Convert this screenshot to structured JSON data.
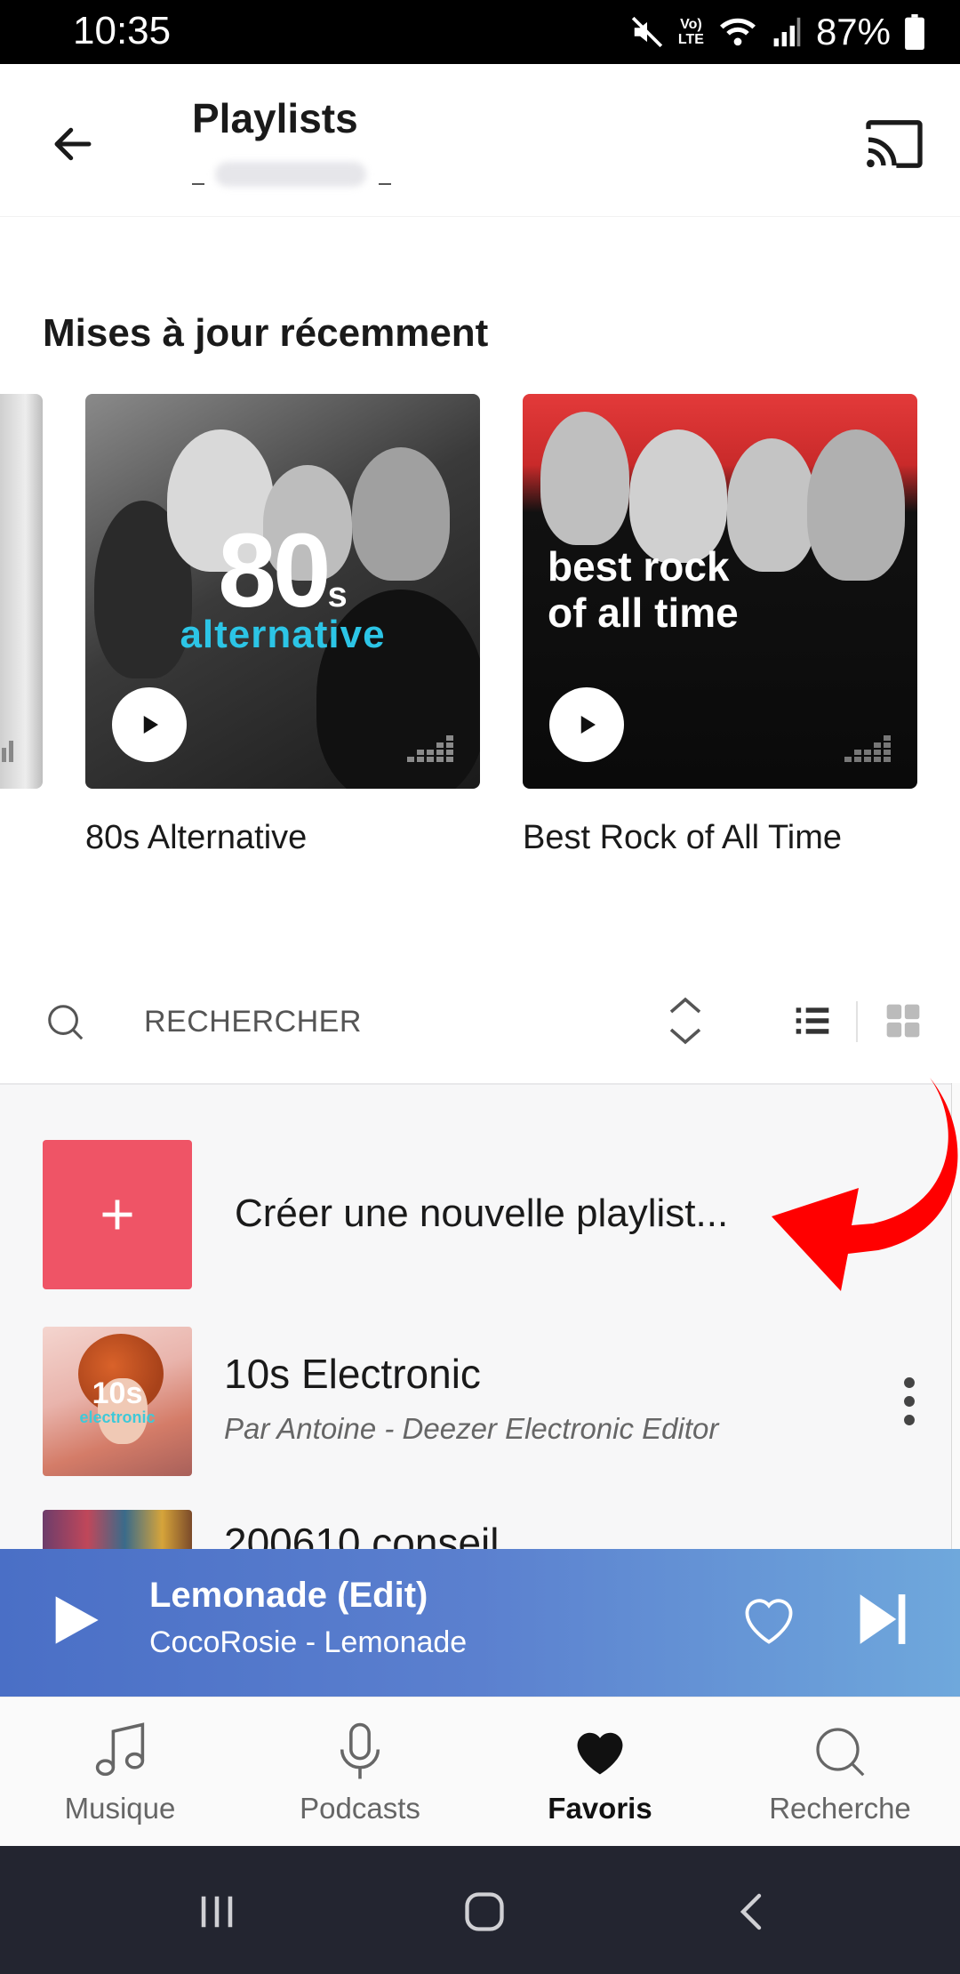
{
  "status_bar": {
    "time": "10:35",
    "network": "LTE",
    "volte": "Vo)",
    "battery": "87%"
  },
  "header": {
    "title": "Playlists"
  },
  "section": {
    "title": "Mises à jour récemment"
  },
  "cards": [
    {
      "cover_line1": "80",
      "cover_suffix": "s",
      "cover_line2": "alternative",
      "label": "80s Alternative"
    },
    {
      "cover_line1": "best rock",
      "cover_line2": "of all time",
      "label": "Best Rock of All Time"
    }
  ],
  "toolbar": {
    "search_placeholder": "RECHERCHER"
  },
  "list": {
    "create_label": "Créer une nouvelle playlist...",
    "items": [
      {
        "title": "10s Electronic",
        "subtitle": "Par Antoine - Deezer Electronic Editor",
        "thumb_line1": "10s",
        "thumb_line2": "electronic"
      },
      {
        "title": "200610 conseil"
      }
    ]
  },
  "player": {
    "track": "Lemonade (Edit)",
    "artist_album": "CocoRosie - Lemonade"
  },
  "bottom_nav": [
    {
      "label": "Musique",
      "icon": "music-note-icon",
      "active": false
    },
    {
      "label": "Podcasts",
      "icon": "microphone-icon",
      "active": false
    },
    {
      "label": "Favoris",
      "icon": "heart-icon",
      "active": true
    },
    {
      "label": "Recherche",
      "icon": "search-icon",
      "active": false
    }
  ],
  "colors": {
    "accent_create": "#ef5466",
    "player_start": "#4a6fc6",
    "player_end": "#6fa8dc",
    "annotation_arrow": "#ff0000",
    "alt_cyan": "#2cc5e6"
  }
}
